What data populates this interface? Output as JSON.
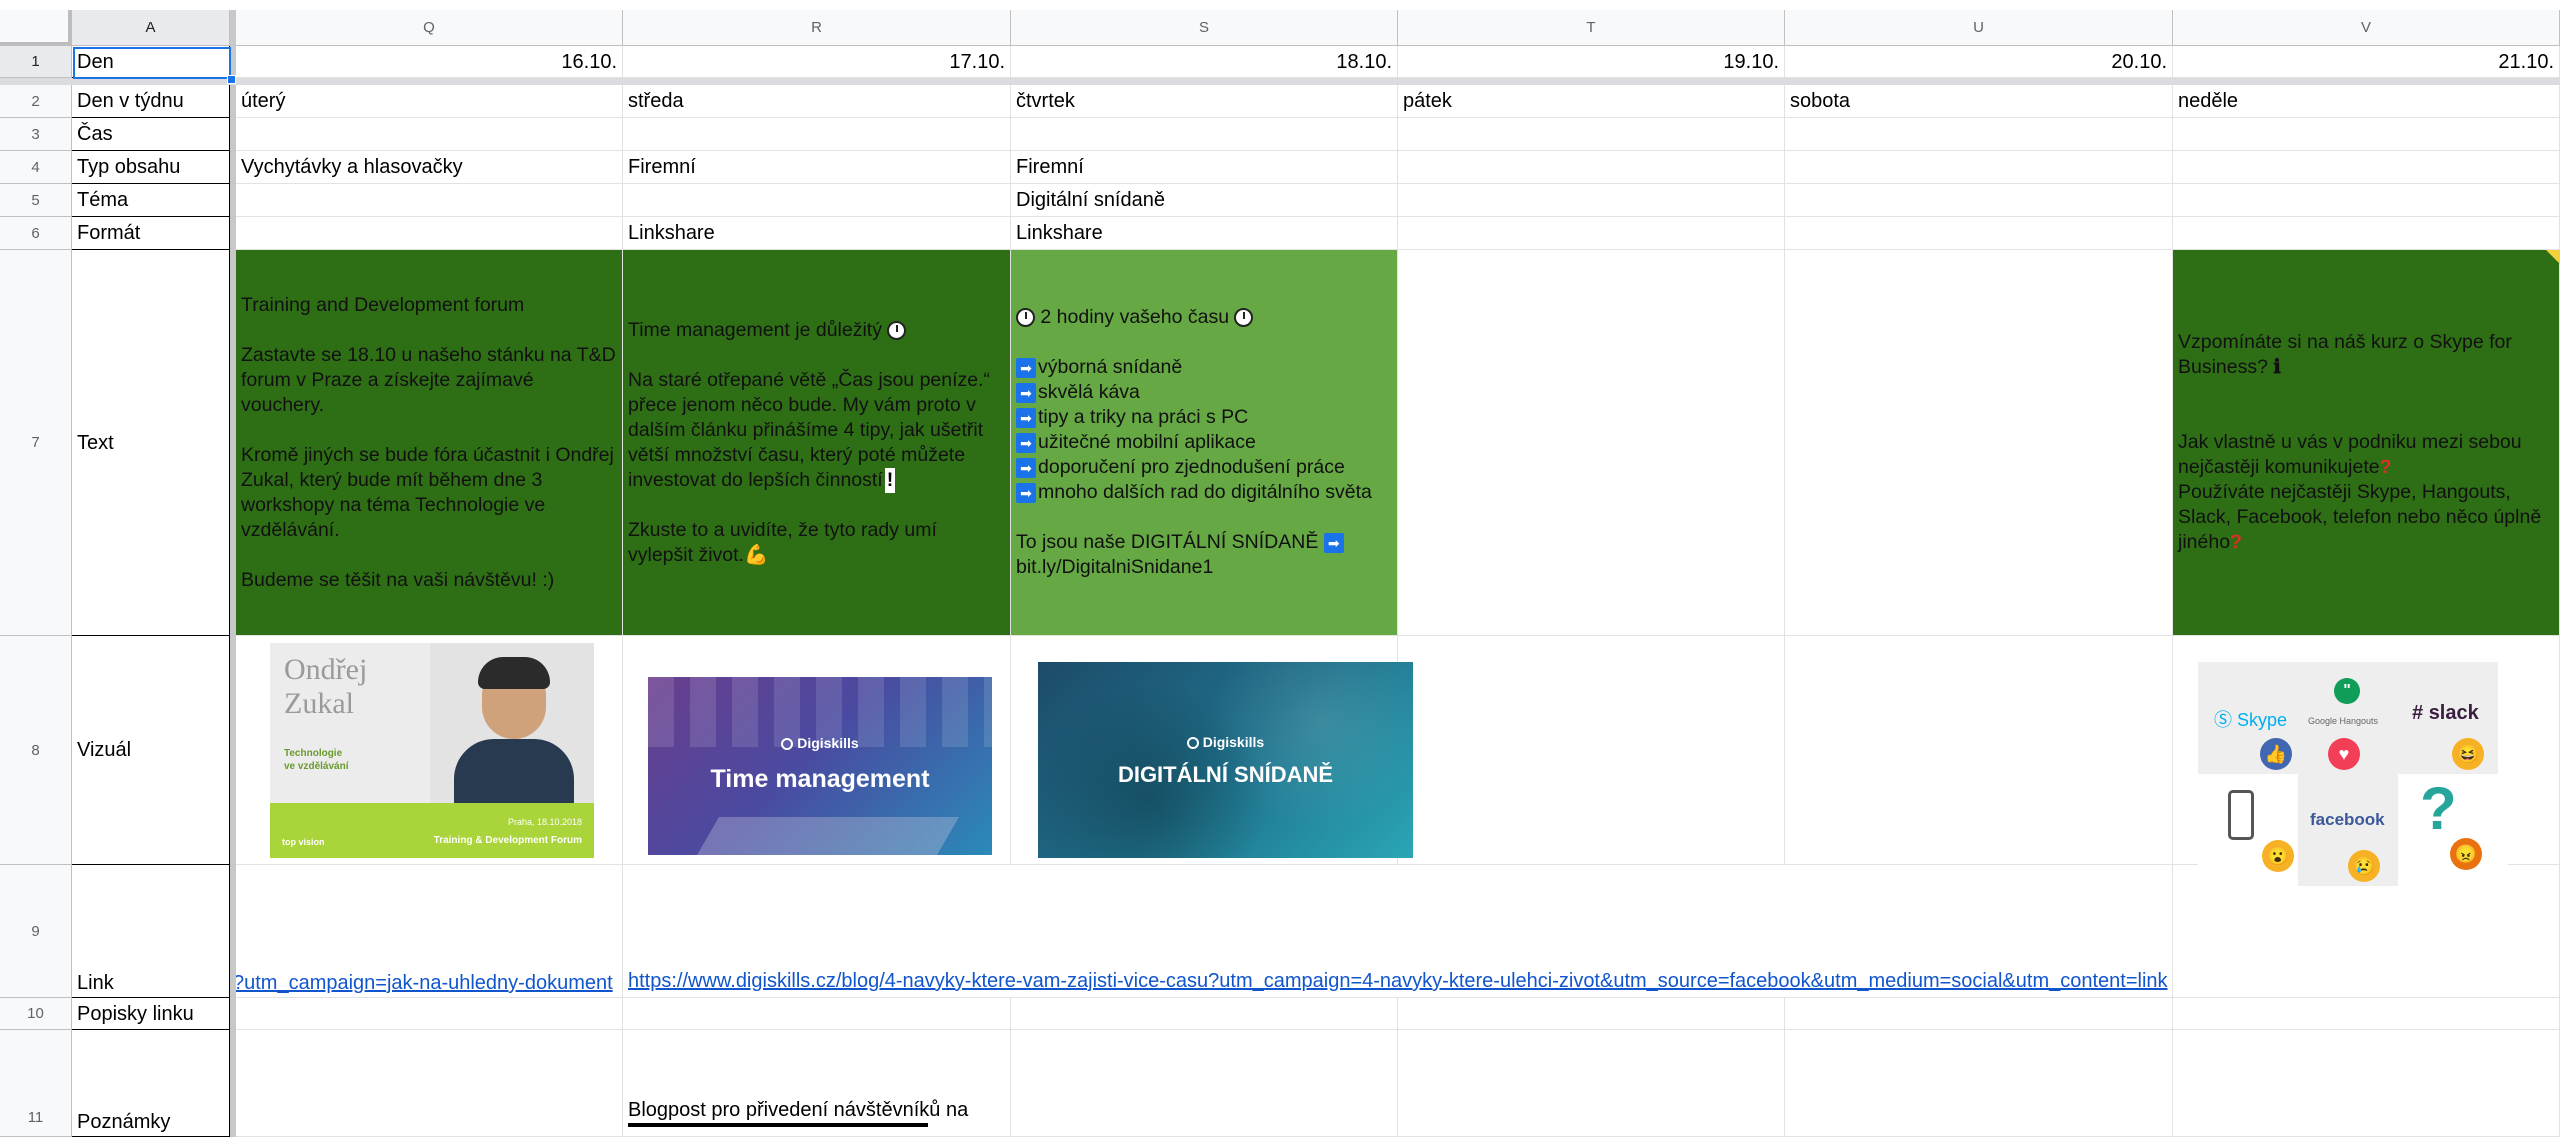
{
  "columns": [
    "A",
    "Q",
    "R",
    "S",
    "T",
    "U",
    "V"
  ],
  "rows": [
    "1",
    "2",
    "3",
    "4",
    "5",
    "6",
    "7",
    "8",
    "9",
    "10",
    "11"
  ],
  "labels": {
    "den": "Den",
    "den_v_tydnu": "Den v týdnu",
    "cas": "Čas",
    "typ_obsahu": "Typ obsahu",
    "tema": "Téma",
    "format": "Formát",
    "text": "Text",
    "vizual": "Vizuál",
    "link": "Link",
    "popisky": "Popisky linku",
    "poznamky": "Poznámky"
  },
  "dates": [
    "16.10.",
    "17.10.",
    "18.10.",
    "19.10.",
    "20.10.",
    "21.10."
  ],
  "weekdays": [
    "úterý",
    "středa",
    "čtvrtek",
    "pátek",
    "sobota",
    "neděle"
  ],
  "typ_obsahu": {
    "q": "Vychytávky a hlasovačky",
    "r": "Firemní",
    "s": "Firemní"
  },
  "tema": {
    "s": "Digitální snídaně"
  },
  "format": {
    "r": "Linkshare",
    "s": "Linkshare"
  },
  "text_q": {
    "p1": "Training and Development forum",
    "p2": "Zastavte se 18.10 u našeho stánku na T&D forum v Praze a získejte zajímavé vouchery.",
    "p3": "Kromě jiných se bude fóra účastnit i Ondřej Zukal, který bude mít během dne 3 workshopy na téma Technologie ve vzdělávání.",
    "p4": "Budeme se těšit na vaši návštěvu! :)"
  },
  "text_r": {
    "p1": "Time management je důležitý",
    "p2": "Na staré otřepané větě „Čas jsou peníze.“ přece jenom něco bude. My vám proto v dalším článku přinášíme 4 tipy, jak ušetřit větší množství času, který poté můžete investovat do lepších činností",
    "p3": "Zkuste to a uvidíte, že tyto rady umí vylepšit život."
  },
  "text_s": {
    "title": "2 hodiny vašeho času",
    "items": [
      "výborná snídaně",
      "skvělá káva",
      "tipy a triky na práci s PC",
      "užitečné mobilní aplikace",
      "doporučení pro zjednodušení práce",
      "mnoho dalších rad do digitálního světa"
    ],
    "outro": "To jsou naše DIGITÁLNÍ SNÍDANĚ",
    "url": "bit.ly/DigitalniSnidane1"
  },
  "text_v": {
    "p1": "Vzpomínáte si na náš kurz o Skype for Business?",
    "p2": "Jak vlastně u vás v podniku mezi sebou nejčastěji komunikujete",
    "p3": "Používáte nejčastěji Skype, Hangouts, Slack, Facebook, telefon nebo něco úplně jiného"
  },
  "visuals": {
    "q_name": "Ondřej Zukal",
    "q_name_line1": "Ondřej",
    "q_name_line2": "Zukal",
    "q_sub1": "Technologie",
    "q_sub2": "ve vzdělávání",
    "q_date": "Praha, 18.10.2018",
    "q_event": "Training & Development Forum",
    "q_logo": "top vision",
    "r_brand": "Digiskills",
    "r_title": "Time management",
    "s_brand": "Digiskills",
    "s_title": "DIGITÁLNÍ SNÍDANĚ",
    "v_skype": "Skype",
    "v_hangouts": "Google Hangouts",
    "v_slack": "slack",
    "v_facebook": "facebook",
    "v_question": "?"
  },
  "links": {
    "q": "?utm_campaign=jak-na-uhledny-dokument",
    "r": "https://www.digiskills.cz/blog/4-navyky-ktere-vam-zajisti-vice-casu?utm_campaign=4-navyky-ktere-ulehci-zivot&utm_source=facebook&utm_medium=social&utm_content=link"
  },
  "poznamky": {
    "r": "Blogpost pro přivedení návštěvníků na"
  },
  "colors": {
    "dark_green": "#2e6f16",
    "light_green": "#65a844",
    "link_blue": "#1155cc",
    "selection_blue": "#1a73e8"
  }
}
